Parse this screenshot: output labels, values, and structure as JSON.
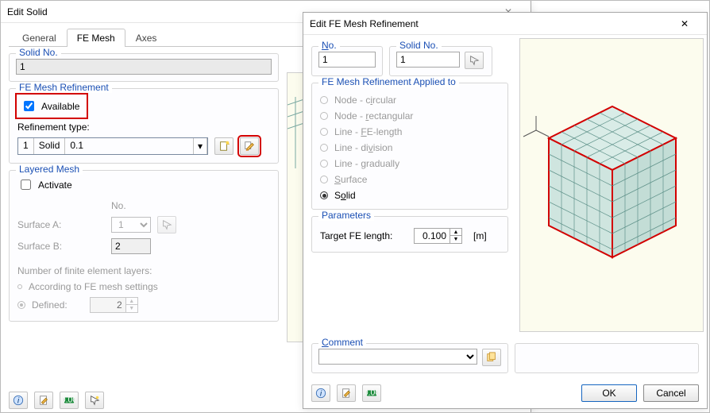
{
  "left": {
    "title": "Edit Solid",
    "tabs": [
      "General",
      "FE Mesh",
      "Axes"
    ],
    "activeTab": 1,
    "solidNo": {
      "label": "Solid No.",
      "value": "1"
    },
    "meshRef": {
      "group": "FE Mesh Refinement",
      "available": {
        "label": "Available",
        "checked": true
      },
      "typeLabel": "Refinement type:",
      "combo": {
        "no": "1",
        "kind": "Solid",
        "val": "0.1"
      }
    },
    "layered": {
      "group": "Layered Mesh",
      "activate": {
        "label": "Activate",
        "checked": false
      },
      "noHeader": "No.",
      "surfA": {
        "label": "Surface A:",
        "value": "1"
      },
      "surfB": {
        "label": "Surface B:",
        "value": "2"
      },
      "layersLabel": "Number of finite element layers:",
      "optAccording": "According to FE mesh settings",
      "optDefined": "Defined:",
      "definedValue": "2"
    }
  },
  "right": {
    "title": "Edit FE Mesh Refinement",
    "no": {
      "label": "No.",
      "value": "1"
    },
    "solidNo": {
      "label": "Solid No.",
      "value": "1"
    },
    "appliedGroup": "FE Mesh Refinement Applied to",
    "opts": {
      "nodeCircular": "Node - circular",
      "nodeRect": "Node - rectangular",
      "lineFE": "Line - FE-length",
      "lineDiv": "Line - division",
      "lineGrad": "Line - gradually",
      "surface": "Surface",
      "solid": "Solid"
    },
    "selected": "solid",
    "params": {
      "group": "Parameters",
      "targetLabel": "Target FE length:",
      "value": "0.100",
      "unit": "[m]"
    },
    "comment": {
      "group": "Comment",
      "value": ""
    },
    "buttons": {
      "ok": "OK",
      "cancel": "Cancel"
    }
  }
}
